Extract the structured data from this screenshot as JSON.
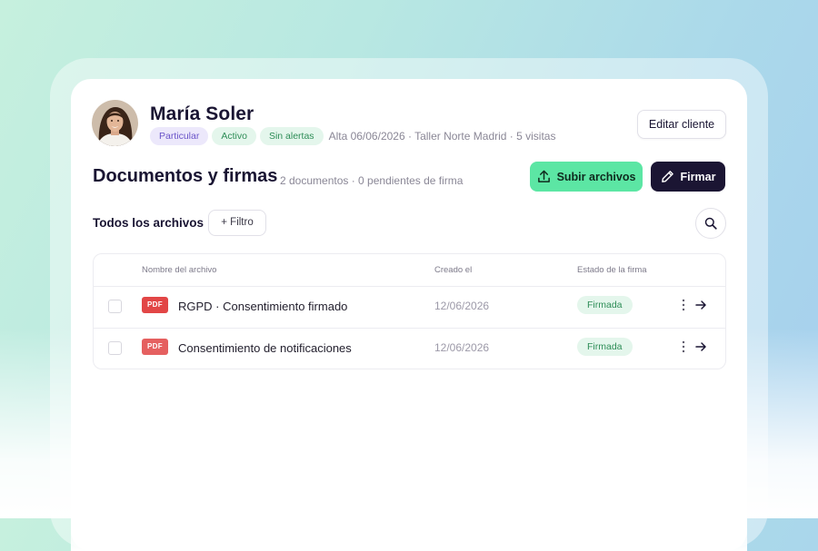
{
  "client": {
    "name": "María Soler",
    "badges": [
      "Particular",
      "Activo",
      "Sin alertas"
    ],
    "meta": "Alta 06/06/2026 · Taller Norte Madrid · 5 visitas",
    "edit_label": "Editar cliente"
  },
  "documents": {
    "title": "Documentos y firmas",
    "meta": "2 documentos · 0 pendientes de firma",
    "upload_label": "Subir archivos",
    "sign_label": "Firmar"
  },
  "toolbar": {
    "all_files_label": "Todos los archivos",
    "filter_label": "+ Filtro"
  },
  "table": {
    "columns": [
      "Nombre del archivo",
      "Creado el",
      "Estado de la firma"
    ],
    "rows": [
      {
        "type": "PDF",
        "name": "RGPD · Consentimiento firmado",
        "created": "12/06/2026",
        "status": "Firmada"
      },
      {
        "type": "PDF",
        "name": "Consentimiento de notificaciones",
        "created": "12/06/2026",
        "status": "Firmada"
      }
    ]
  },
  "colors": {
    "upload_accent": "#5ce6a4",
    "sign_dark": "#1b1533",
    "pdf_red": "#e24646",
    "status_green": "#2e8d57"
  }
}
